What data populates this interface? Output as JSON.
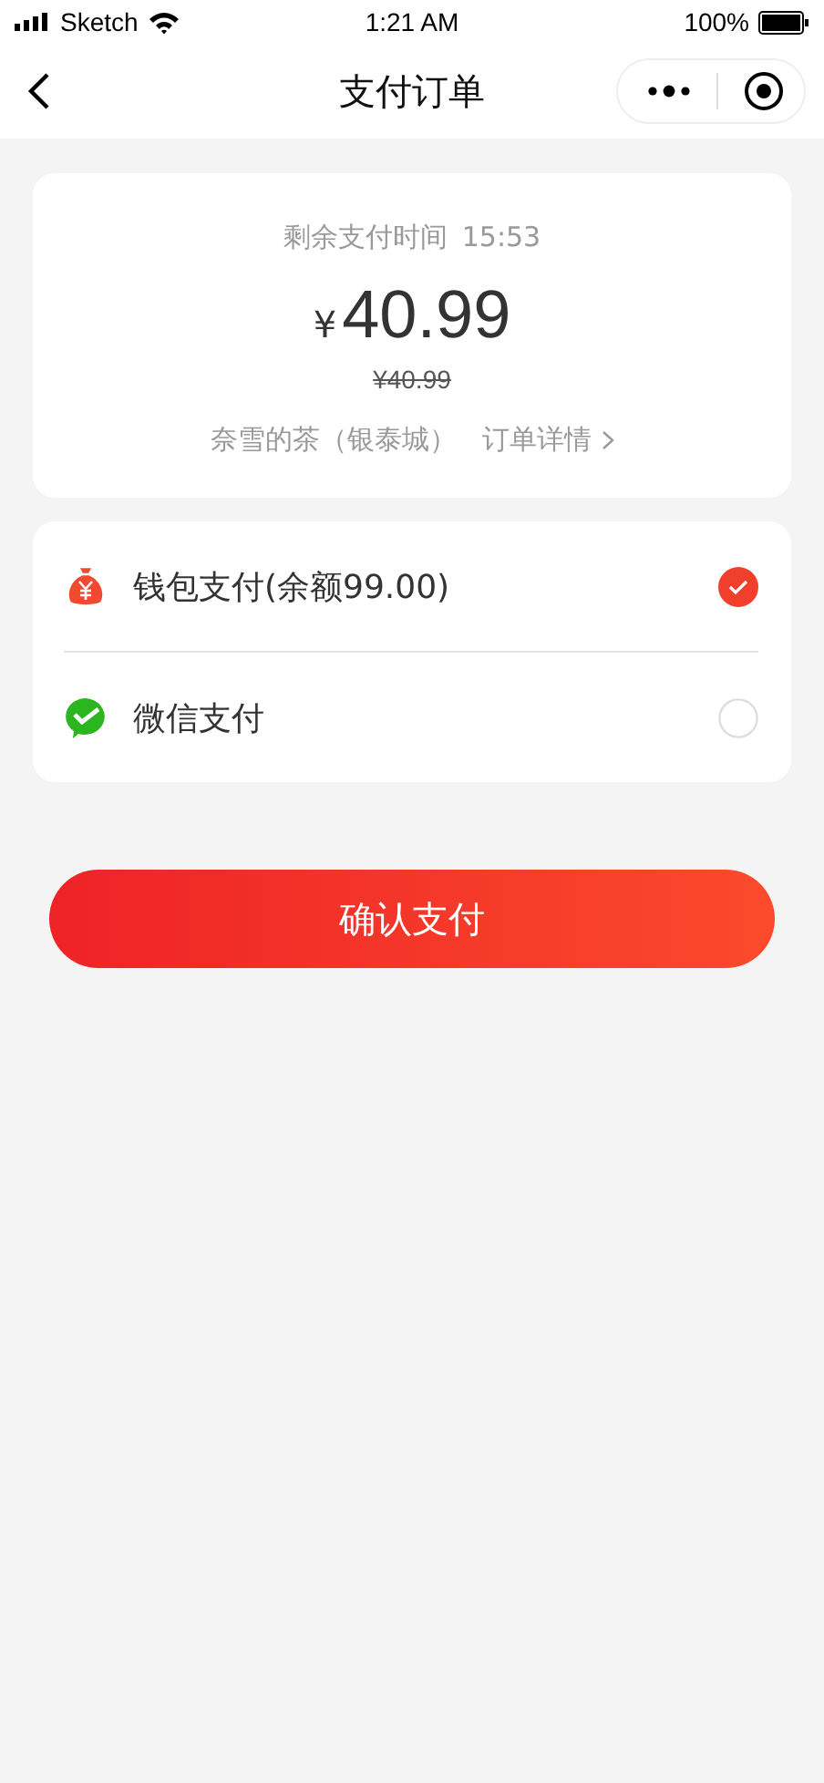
{
  "status_bar": {
    "carrier": "Sketch",
    "time": "1:21 AM",
    "battery": "100%"
  },
  "nav": {
    "title": "支付订单"
  },
  "order": {
    "countdown_label": "剩余支付时间",
    "countdown": "15:53",
    "currency": "¥",
    "amount": "40.99",
    "original_price": "¥40.99",
    "shop": "奈雪的茶（银泰城）",
    "details_link": "订单详情"
  },
  "payment_methods": [
    {
      "kind": "wallet",
      "label": "钱包支付(余额99.00)",
      "selected": true
    },
    {
      "kind": "wechat",
      "label": "微信支付",
      "selected": false
    }
  ],
  "confirm_button": "确认支付"
}
